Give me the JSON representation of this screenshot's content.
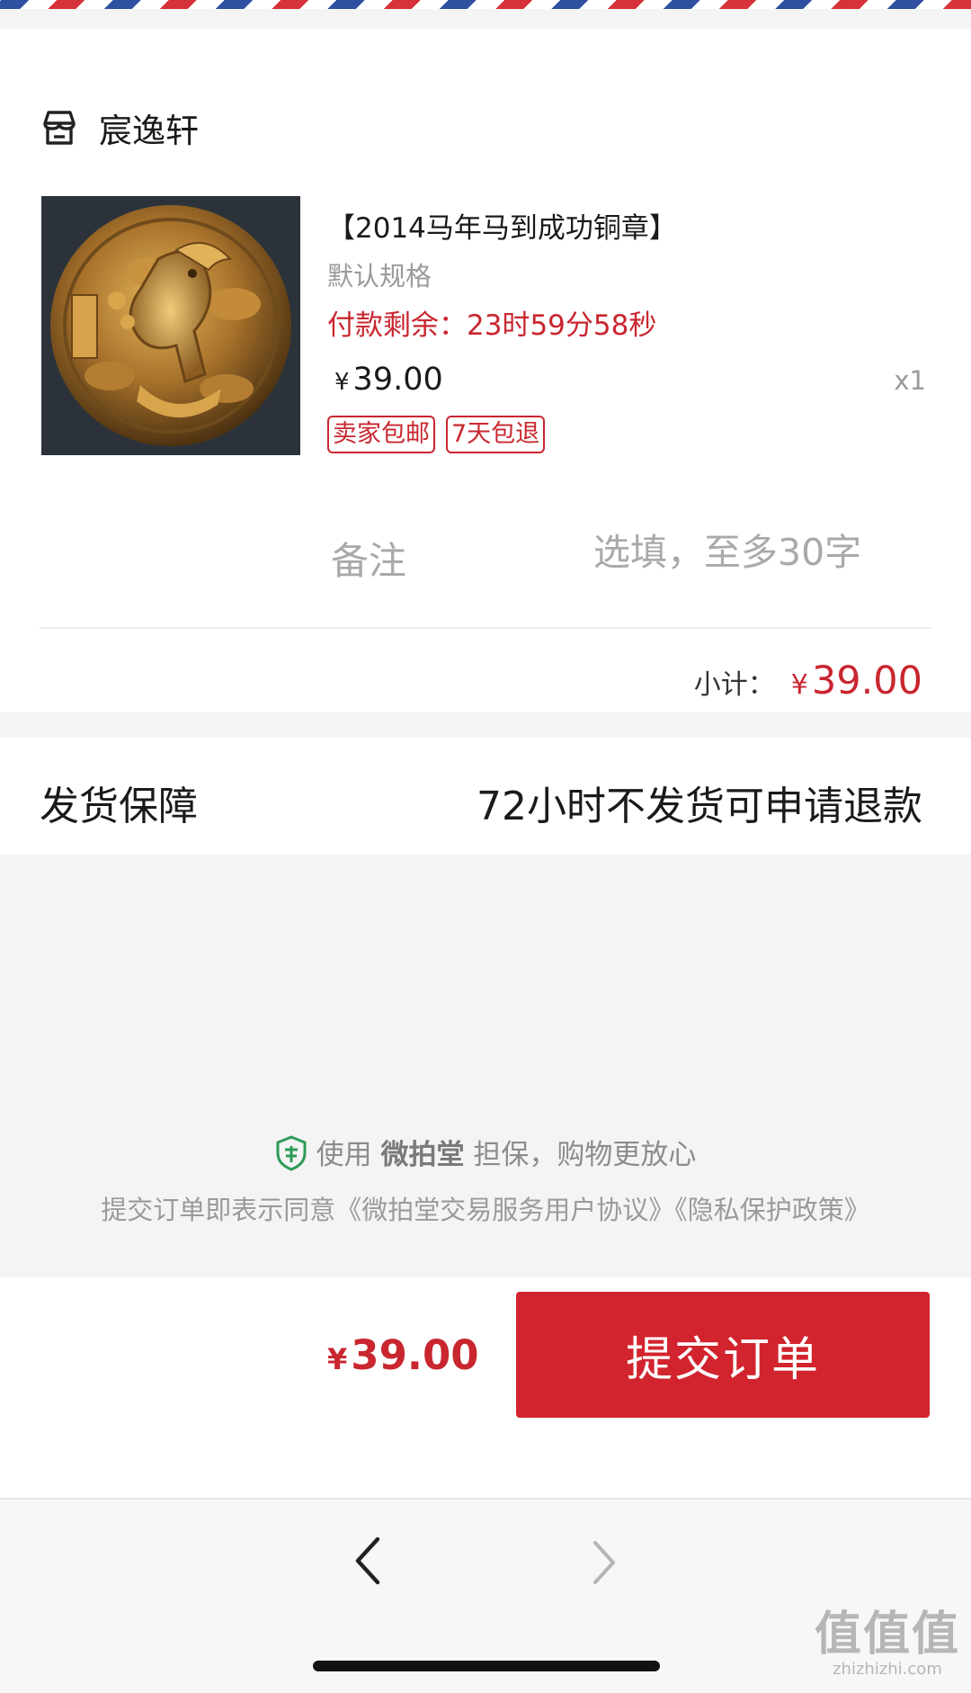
{
  "shop": {
    "name": "宸逸轩",
    "icon": "store-icon"
  },
  "product": {
    "title": "【2014马年马到成功铜章】",
    "spec": "默认规格",
    "countdown": "付款剩余：23时59分58秒",
    "currency": "¥",
    "price": "39.00",
    "quantity": "x1",
    "image": "horse-medal-image",
    "tags": [
      "卖家包邮",
      "7天包退"
    ]
  },
  "note": {
    "label": "备注",
    "placeholder": "选填，至多30字"
  },
  "subtotal": {
    "label": "小计：",
    "currency": "¥",
    "value": "39.00"
  },
  "shipping": {
    "label": "发货保障",
    "value": "72小时不发货可申请退款"
  },
  "guarantee": {
    "prefix": "使用 ",
    "brand": "微拍堂",
    "suffix": " 担保，购物更放心",
    "icon": "shield-icon"
  },
  "agreement": {
    "text": "提交订单即表示同意《微拍堂交易服务用户协议》《隐私保护政策》"
  },
  "footer": {
    "currency": "¥",
    "total": "39.00",
    "submit_label": "提交订单"
  },
  "nav": {
    "back_icon": "chevron-left-icon",
    "forward_icon": "chevron-right-icon"
  },
  "watermark": {
    "glyphs": "值值值",
    "url": "zhizhizhi.com"
  },
  "colors": {
    "accent": "#d2242e",
    "price": "#c9262f",
    "muted": "#9a9a9a"
  }
}
